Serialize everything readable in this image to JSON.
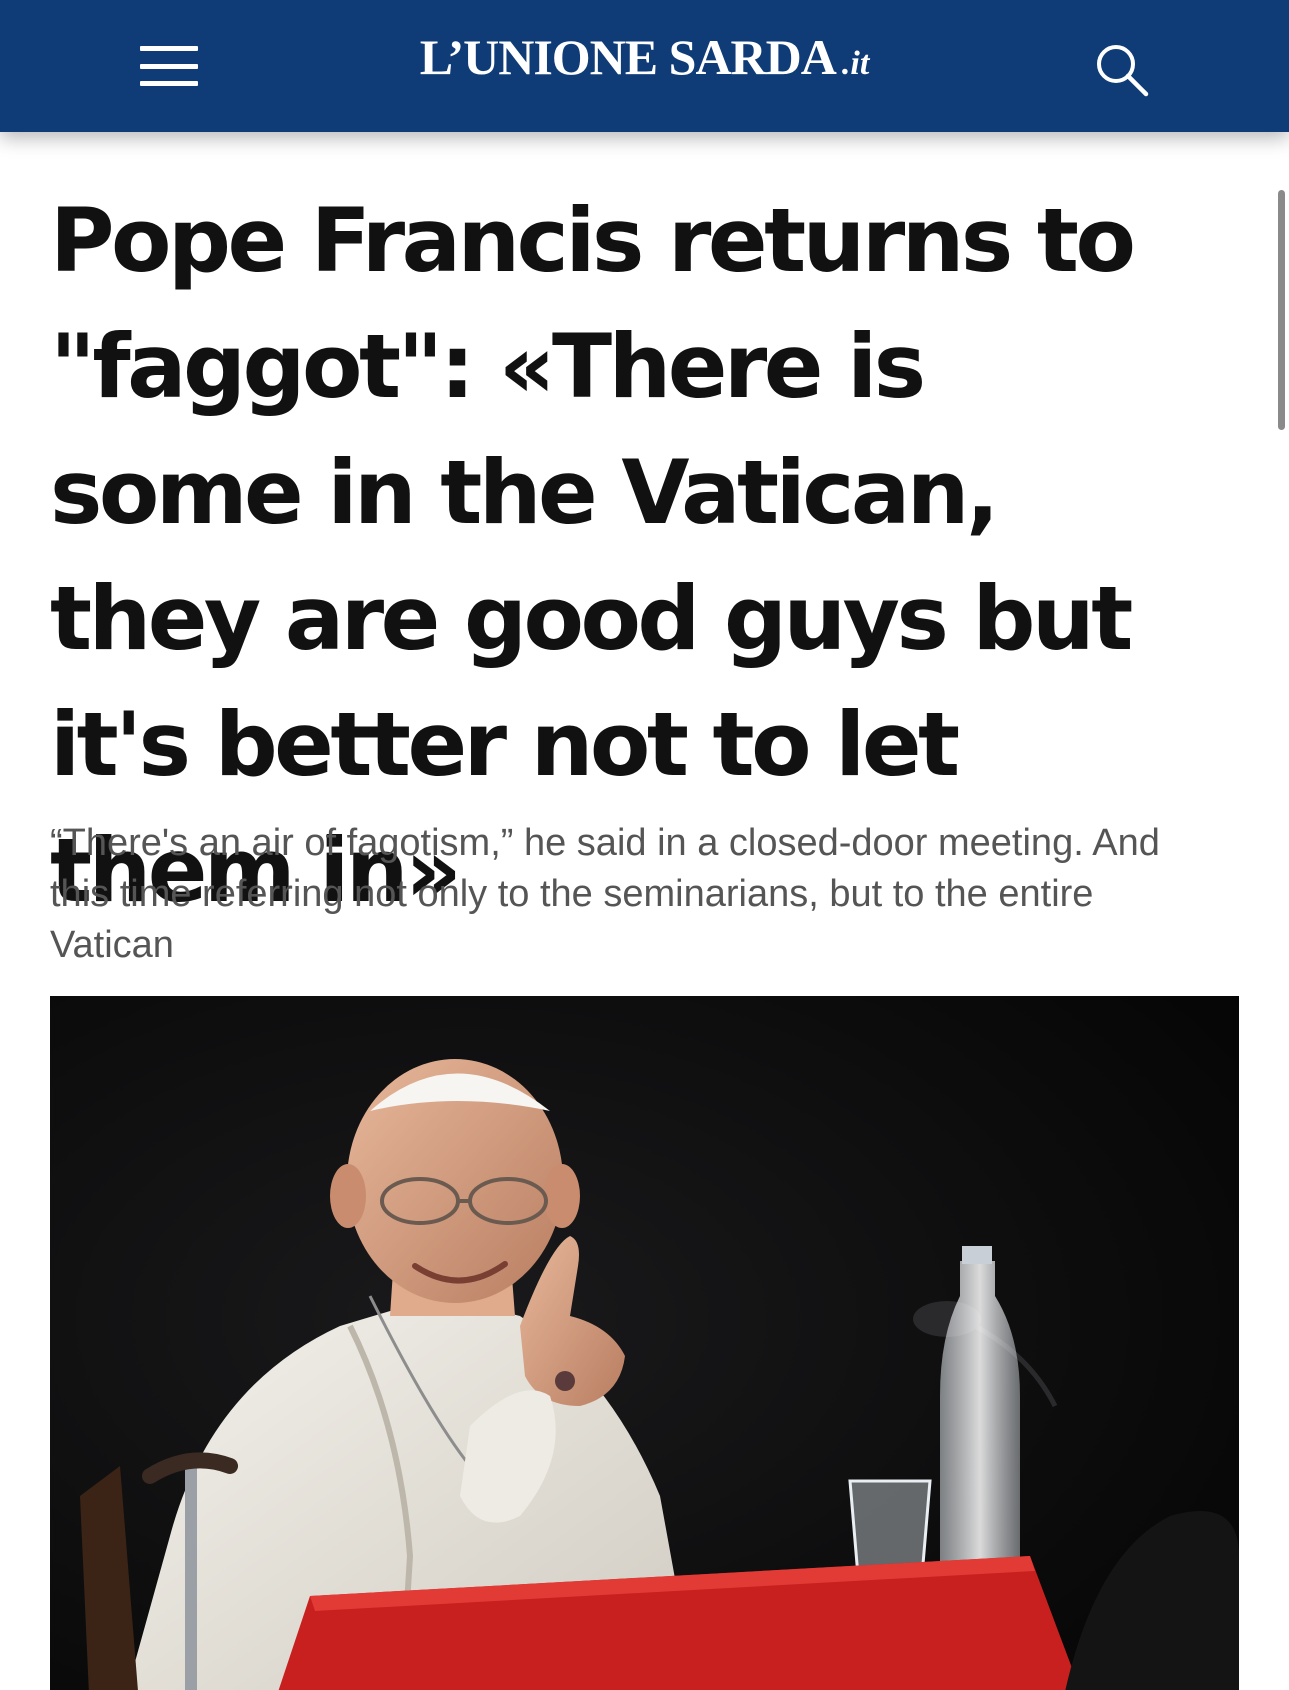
{
  "header": {
    "logo_text": "L’UNIONE SARDA",
    "logo_tld": ".it",
    "brand_color": "#0f3b77",
    "menu_icon": "hamburger-menu-icon",
    "search_icon": "search-icon"
  },
  "article": {
    "headline": "Pope Francis returns to \"faggot\": «There is some in the Vatican, they are good guys but it's better not to let them in»",
    "subtitle": "“There's an air of fagotism,” he said in a closed-door meeting. And this time referring not only to the seminarians, but to the entire Vatican"
  }
}
